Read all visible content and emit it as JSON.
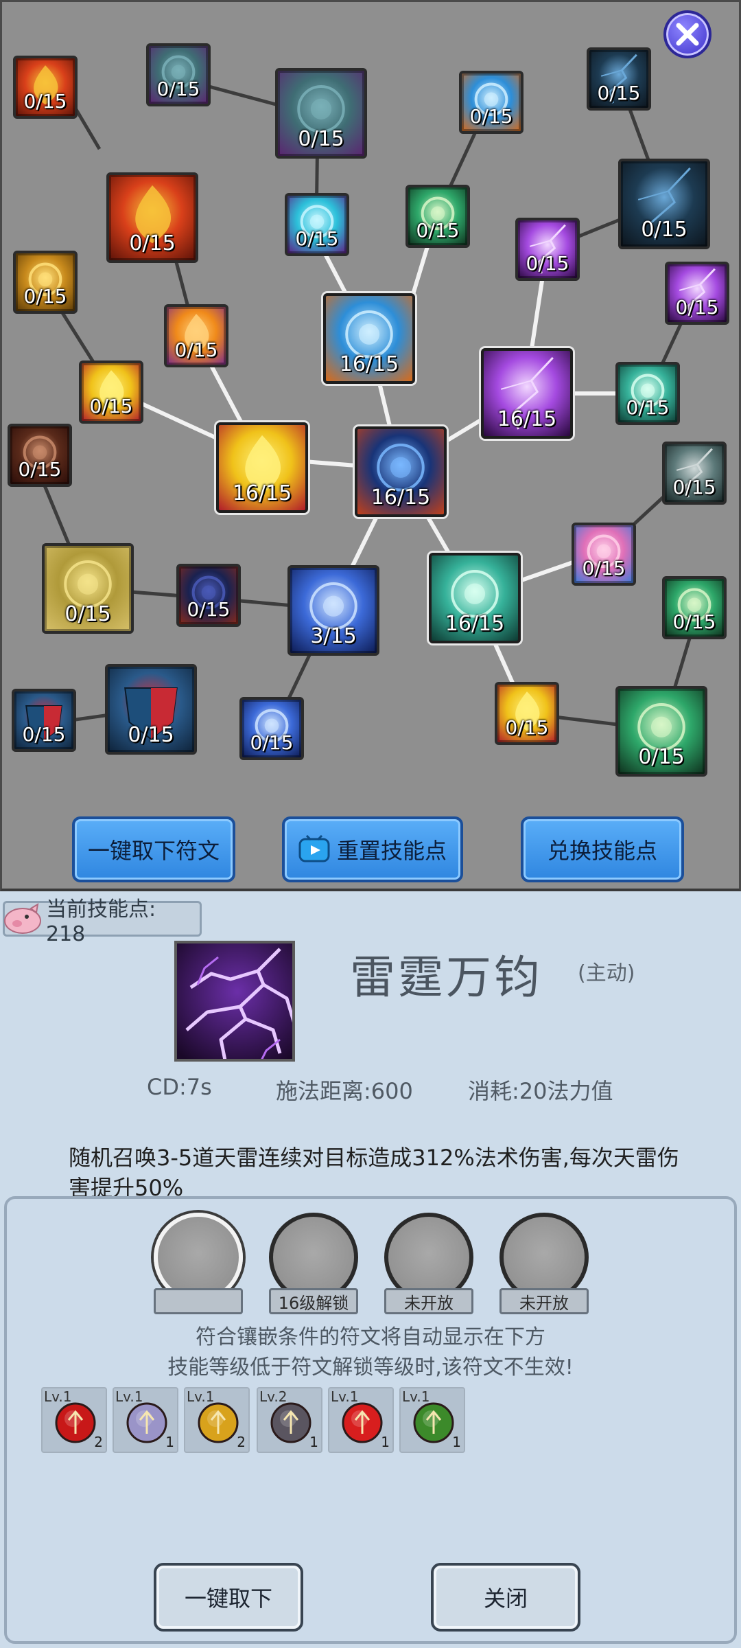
{
  "colors": {
    "bolt_purple": "#b66cf2",
    "button_blue": "#2f86e0",
    "panel_bg": "#ccdbea"
  },
  "tree": {
    "close_icon": "close-icon",
    "nodes": [
      {
        "id": "fire-small",
        "level": "0/15",
        "theme": "fire",
        "active": false
      },
      {
        "id": "water-wave-small",
        "level": "0/15",
        "theme": "water",
        "active": false
      },
      {
        "id": "water-wave-large",
        "level": "0/15",
        "theme": "water",
        "active": false
      },
      {
        "id": "frost-giant-small",
        "level": "0/15",
        "theme": "frost",
        "active": false
      },
      {
        "id": "ice-storm-small",
        "level": "0/15",
        "theme": "storm",
        "active": false
      },
      {
        "id": "fire-large",
        "level": "0/15",
        "theme": "fire",
        "active": false
      },
      {
        "id": "water-swirl",
        "level": "0/15",
        "theme": "cyan",
        "active": false
      },
      {
        "id": "water-splash",
        "level": "0/15",
        "theme": "green",
        "active": false
      },
      {
        "id": "lightning-demon",
        "level": "0/15",
        "theme": "purple",
        "active": false
      },
      {
        "id": "ice-storm-large",
        "level": "0/15",
        "theme": "storm",
        "active": false
      },
      {
        "id": "earth-skull",
        "level": "0/15",
        "theme": "gold",
        "active": false
      },
      {
        "id": "fire-dragon",
        "level": "0/15",
        "theme": "orange",
        "active": false
      },
      {
        "id": "ice-giant",
        "level": "16/15",
        "theme": "frost",
        "active": true
      },
      {
        "id": "lightning-small",
        "level": "0/15",
        "theme": "purple",
        "active": false
      },
      {
        "id": "gold-burst",
        "level": "0/15",
        "theme": "yellow",
        "active": false
      },
      {
        "id": "thunder-strike",
        "level": "16/15",
        "theme": "purple",
        "active": true
      },
      {
        "id": "wind-bow",
        "level": "0/15",
        "theme": "teal",
        "active": false
      },
      {
        "id": "shield-bash",
        "level": "0/15",
        "theme": "brown",
        "active": false
      },
      {
        "id": "golden-flames",
        "level": "16/15",
        "theme": "yellow",
        "active": true
      },
      {
        "id": "shadow-hawk",
        "level": "16/15",
        "theme": "dark",
        "active": true
      },
      {
        "id": "storm-claw",
        "level": "0/15",
        "theme": "gray",
        "active": false
      },
      {
        "id": "bell-guard",
        "level": "0/15",
        "theme": "olive",
        "active": false
      },
      {
        "id": "shadow-dash",
        "level": "0/15",
        "theme": "navy",
        "active": false
      },
      {
        "id": "arcane-mage",
        "level": "3/15",
        "theme": "blue",
        "active": false
      },
      {
        "id": "wind-slash",
        "level": "16/15",
        "theme": "teal",
        "active": true
      },
      {
        "id": "grab-hand",
        "level": "0/15",
        "theme": "pink",
        "active": false
      },
      {
        "id": "tornado-small",
        "level": "0/15",
        "theme": "green",
        "active": false
      },
      {
        "id": "guard-shield-small",
        "level": "0/15",
        "theme": "shield",
        "active": false
      },
      {
        "id": "guard-shield-large",
        "level": "0/15",
        "theme": "shield",
        "active": false
      },
      {
        "id": "mage-small",
        "level": "0/15",
        "theme": "blue",
        "active": false
      },
      {
        "id": "sand-wind",
        "level": "0/15",
        "theme": "yellow",
        "active": false
      },
      {
        "id": "tornado-large",
        "level": "0/15",
        "theme": "green",
        "active": false
      }
    ],
    "buttons": {
      "remove_runes": "一键取下符文",
      "reset_points": "重置技能点",
      "exchange_points": "兑换技能点"
    }
  },
  "detail": {
    "points_label": "当前技能点: 218",
    "skill_name": "雷霆万钧",
    "skill_type": "(主动)",
    "cd": "CD:7s",
    "range": "施法距离:600",
    "cost": "消耗:20法力值",
    "description": "随机召唤3-5道天雷连续对目标造成312%法术伤害,每次天雷伤害提升50%",
    "slots": [
      {
        "label": ""
      },
      {
        "label": "16级解锁"
      },
      {
        "label": "未开放"
      },
      {
        "label": "未开放"
      }
    ],
    "hint_line1": "符合镶嵌条件的符文将自动显示在下方",
    "hint_line2": "技能等级低于符文解锁等级时,该符文不生效!",
    "runes": [
      {
        "lv": "Lv.1",
        "count": "2",
        "icon": "red-arrow-rune-icon",
        "color": "#c81818"
      },
      {
        "lv": "Lv.1",
        "count": "1",
        "icon": "silver-ring-rune-icon",
        "color": "#9a94c8"
      },
      {
        "lv": "Lv.1",
        "count": "2",
        "icon": "gold-arrow-rune-icon",
        "color": "#d8a21c"
      },
      {
        "lv": "Lv.2",
        "count": "1",
        "icon": "purple-crystal-rune-icon",
        "color": "#5a5560"
      },
      {
        "lv": "Lv.1",
        "count": "1",
        "icon": "fire-rune-icon",
        "color": "#d81e1e"
      },
      {
        "lv": "Lv.1",
        "count": "1",
        "icon": "green-trident-rune-icon",
        "color": "#3c8a2a"
      }
    ],
    "buttons": {
      "remove_all": "一键取下",
      "close": "关闭"
    }
  }
}
